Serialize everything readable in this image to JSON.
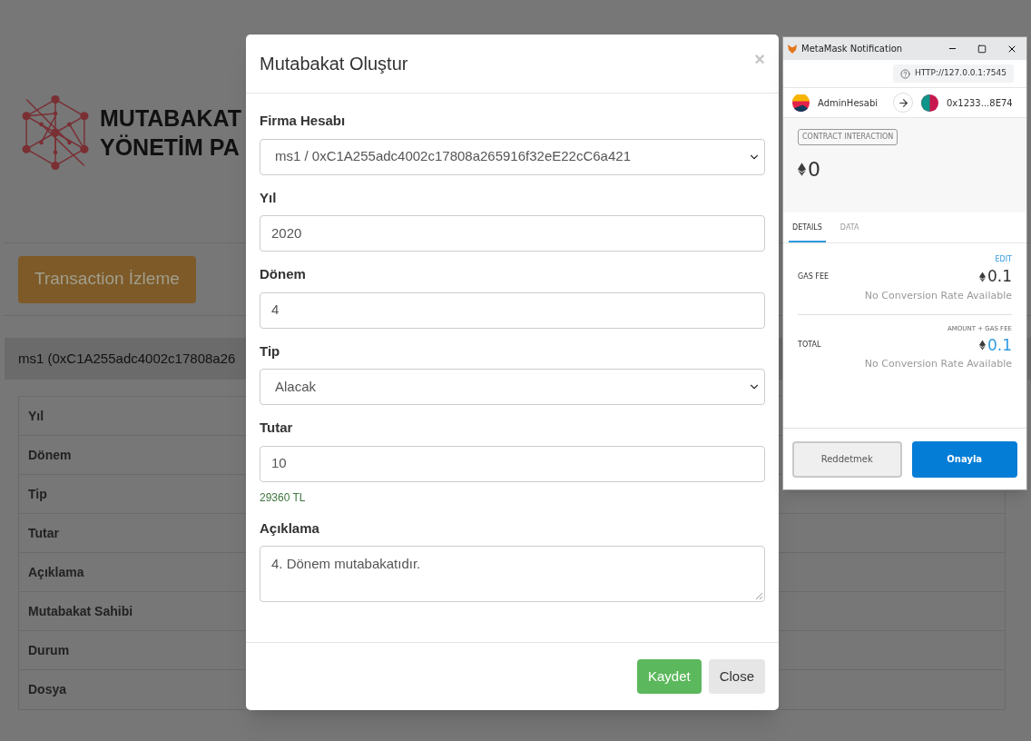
{
  "background": {
    "logo_lines": [
      "MUTABAKAT",
      "YÖNETİM PA"
    ],
    "transaction_button": "Transaction İzleme",
    "account_heading": "ms1 (0xC1A255adc4002c17808a26",
    "table_rows": [
      "Yıl",
      "Dönem",
      "Tip",
      "Tutar",
      "Açıklama",
      "Mutabakat Sahibi",
      "Durum",
      "Dosya"
    ]
  },
  "modal": {
    "title": "Mutabakat Oluştur",
    "close": "×",
    "fields": [
      {
        "kind": "select",
        "label": "Firma Hesabı",
        "value": "ms1 / 0xC1A255adc4002c17808a265916f32eE22cC6a421"
      },
      {
        "kind": "input",
        "label": "Yıl",
        "value": "2020"
      },
      {
        "kind": "input",
        "label": "Dönem",
        "value": "4"
      },
      {
        "kind": "select",
        "label": "Tip",
        "value": "Alacak"
      },
      {
        "kind": "input",
        "label": "Tutar",
        "value": "10",
        "help": "29360 TL"
      },
      {
        "kind": "textarea",
        "label": "Açıklama",
        "value": "4. Dönem mutabakatıdır."
      }
    ],
    "buttons": [
      {
        "label": "Kaydet",
        "kind": "primary"
      },
      {
        "label": "Close",
        "kind": "default"
      }
    ]
  },
  "metamask": {
    "title": "MetaMask Notification",
    "origin": "HTTP://127.0.0.1:7545",
    "from": "AdminHesabi",
    "to": "0x1233...8E74",
    "badge": "CONTRACT INTERACTION",
    "amount": "0",
    "tabs": [
      {
        "label": "DETAILS",
        "selected": true
      },
      {
        "label": "DATA",
        "selected": false
      }
    ],
    "gas_fee": {
      "label": "GAS FEE",
      "action": "EDIT",
      "amount": "0.1",
      "conversion": "No Conversion Rate Available"
    },
    "total": {
      "label": "TOTAL",
      "sublabel": "AMOUNT + GAS FEE",
      "amount": "0.1",
      "conversion": "No Conversion Rate Available"
    },
    "buttons": [
      {
        "label": "Reddetmek",
        "kind": "secondary"
      },
      {
        "label": "Onayla",
        "kind": "primary"
      }
    ]
  }
}
